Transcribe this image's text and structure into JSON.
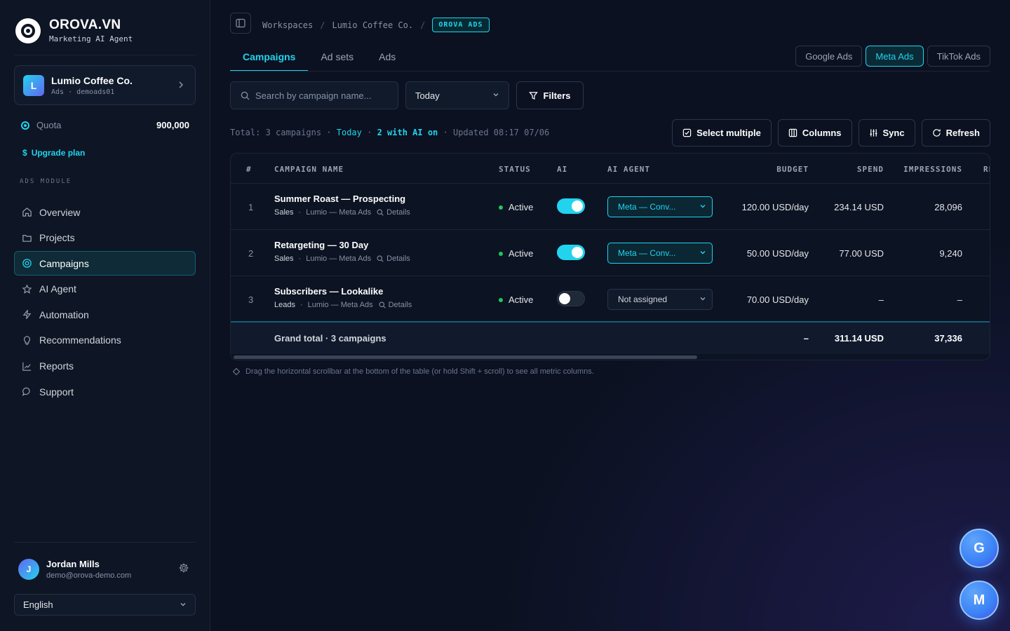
{
  "brand": {
    "name": "OROVA.VN",
    "subtitle": "Marketing AI Agent"
  },
  "workspace": {
    "initial": "L",
    "name": "Lumio Coffee Co.",
    "sub": "Ads · demoads01"
  },
  "quota": {
    "label": "Quota",
    "value": "900,000"
  },
  "upgrade": {
    "icon": "$",
    "label": "Upgrade plan"
  },
  "sidebar": {
    "section_label": "ADS MODULE",
    "items": [
      {
        "label": "Overview",
        "icon": "home-icon"
      },
      {
        "label": "Projects",
        "icon": "folder-icon"
      },
      {
        "label": "Campaigns",
        "icon": "target-icon",
        "active": true
      },
      {
        "label": "AI Agent",
        "icon": "star-icon"
      },
      {
        "label": "Automation",
        "icon": "bolt-icon"
      },
      {
        "label": "Recommendations",
        "icon": "lightbulb-icon"
      },
      {
        "label": "Reports",
        "icon": "chart-icon"
      },
      {
        "label": "Support",
        "icon": "chat-icon"
      }
    ]
  },
  "user": {
    "initial": "J",
    "name": "Jordan Mills",
    "email": "demo@orova-demo.com"
  },
  "language": {
    "selected": "English"
  },
  "breadcrumb": {
    "items": [
      "Workspaces",
      "Lumio Coffee Co."
    ],
    "sep": "/",
    "badge": "OROVA ADS"
  },
  "tabs": [
    "Campaigns",
    "Ad sets",
    "Ads"
  ],
  "platforms": [
    {
      "label": "Google Ads",
      "active": false
    },
    {
      "label": "Meta Ads",
      "active": true
    },
    {
      "label": "TikTok Ads",
      "active": false
    }
  ],
  "search": {
    "placeholder": "Search by campaign name..."
  },
  "date_filter": {
    "selected": "Today"
  },
  "filters_label": "Filters",
  "summary": {
    "total": "Total: 3 campaigns",
    "sep": "·",
    "range": "Today",
    "ai_on": "2 with AI on",
    "updated": "Updated 08:17 07/06"
  },
  "actions": {
    "select_multiple": "Select multiple",
    "columns": "Columns",
    "sync": "Sync",
    "refresh": "Refresh"
  },
  "table": {
    "headers": {
      "idx": "#",
      "name": "CAMPAIGN NAME",
      "status": "STATUS",
      "ai": "AI",
      "agent": "AI AGENT",
      "budget": "BUDGET",
      "spend": "SPEND",
      "impressions": "IMPRESSIONS",
      "cut": "RE"
    },
    "rows": [
      {
        "idx": "1",
        "name": "Summer Roast — Prospecting",
        "objective": "Sales",
        "account": "Lumio — Meta Ads",
        "details": "Details",
        "status": "Active",
        "ai_on": true,
        "agent": "Meta — Conv...",
        "budget": "120.00 USD/day",
        "spend": "234.14 USD",
        "impressions": "28,096"
      },
      {
        "idx": "2",
        "name": "Retargeting — 30 Day",
        "objective": "Sales",
        "account": "Lumio — Meta Ads",
        "details": "Details",
        "status": "Active",
        "ai_on": true,
        "agent": "Meta — Conv...",
        "budget": "50.00 USD/day",
        "spend": "77.00 USD",
        "impressions": "9,240"
      },
      {
        "idx": "3",
        "name": "Subscribers — Lookalike",
        "objective": "Leads",
        "account": "Lumio — Meta Ads",
        "details": "Details",
        "status": "Active",
        "ai_on": false,
        "agent": "Not assigned",
        "budget": "70.00 USD/day",
        "spend": "–",
        "impressions": "–"
      }
    ],
    "total": {
      "label": "Grand total · 3 campaigns",
      "budget": "–",
      "spend": "311.14 USD",
      "impressions": "37,336"
    }
  },
  "hint": "Drag the horizontal scrollbar at the bottom of the table (or hold Shift + scroll) to see all metric columns.",
  "fabs": [
    "G",
    "M"
  ],
  "colors": {
    "accent": "#22d3ee",
    "active_status": "#22c55e",
    "background": "#0b1120"
  }
}
